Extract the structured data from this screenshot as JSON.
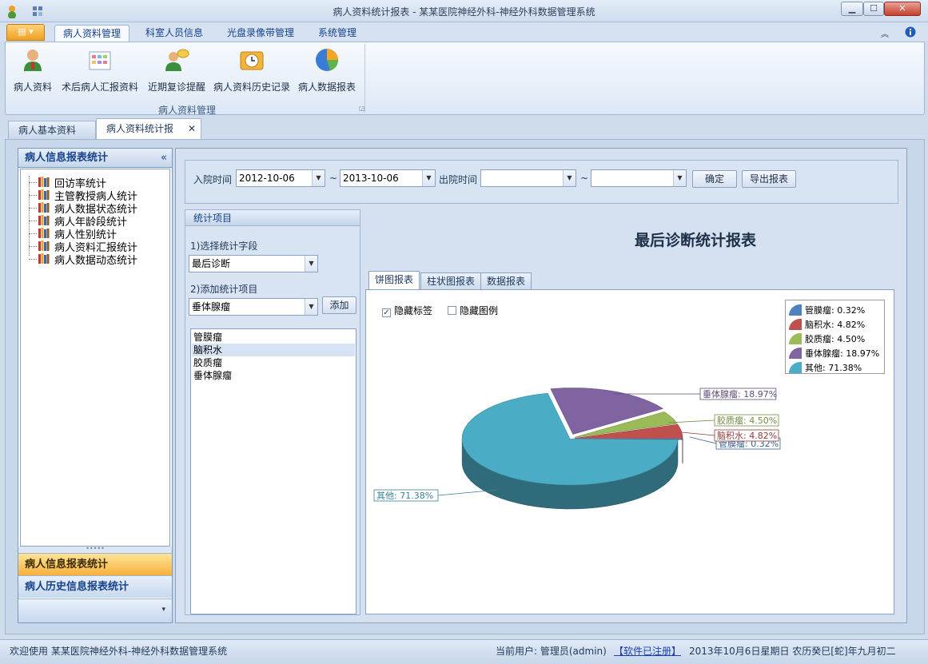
{
  "window": {
    "title": "病人资料统计报表 - 某某医院神经外科-神经外科数据管理系统"
  },
  "ribbon": {
    "tabs": [
      "病人资料管理",
      "科室人员信息",
      "光盘录像带管理",
      "系统管理"
    ],
    "buttons": [
      "病人资料",
      "术后病人汇报资料",
      "近期复诊提醒",
      "病人资料历史记录",
      "病人数据报表"
    ],
    "group_label": "病人资料管理"
  },
  "doc_tabs": [
    "病人基本资料",
    "病人资料统计报表"
  ],
  "leftnav": {
    "header": "病人信息报表统计",
    "collapse": "«",
    "tree": [
      "回访率统计",
      "主管教授病人统计",
      "病人数据状态统计",
      "病人年龄段统计",
      "病人性别统计",
      "病人资料汇报统计",
      "病人数据动态统计"
    ],
    "bottom_buttons": [
      "病人信息报表统计",
      "病人历史信息报表统计"
    ]
  },
  "filter": {
    "admit_label": "入院时间",
    "admit_from": "2012-10-06",
    "tilde": "~",
    "admit_to": "2013-10-06",
    "discharge_label": "出院时间",
    "discharge_from": "",
    "discharge_to": "",
    "confirm": "确定",
    "export": "导出报表"
  },
  "stats": {
    "title": "统计项目",
    "step1": "1)选择统计字段",
    "field": "最后诊断",
    "step2": "2)添加统计项目",
    "item": "垂体腺瘤",
    "add": "添加",
    "list": [
      "管膜瘤",
      "脑积水",
      "胶质瘤",
      "垂体腺瘤"
    ]
  },
  "report": {
    "title": "最后诊断统计报表",
    "tabs": [
      "饼图报表",
      "柱状图报表",
      "数据报表"
    ],
    "hide_labels": "隐藏标签",
    "hide_legend": "隐藏图例"
  },
  "chart_data": {
    "type": "pie",
    "title": "最后诊断统计报表",
    "categories": [
      "管膜瘤",
      "脑积水",
      "胶质瘤",
      "垂体腺瘤",
      "其他"
    ],
    "values": [
      0.32,
      4.82,
      4.5,
      18.97,
      71.38
    ],
    "labels": [
      "管膜瘤: 0.32%",
      "脑积水: 4.82%",
      "胶质瘤: 4.50%",
      "垂体腺瘤: 18.97%",
      "其他: 71.38%"
    ],
    "colors": [
      "#4f81bd",
      "#c0504d",
      "#9bbb59",
      "#8064a2",
      "#4bacc6"
    ],
    "legend": "top-right"
  },
  "statusbar": {
    "welcome": "欢迎使用 某某医院神经外科-神经外科数据管理系统",
    "user": "当前用户: 管理员(admin)",
    "registered": "【软件已注册】",
    "date": "2013年10月6日星期日 农历癸巳[蛇]年九月初二"
  }
}
